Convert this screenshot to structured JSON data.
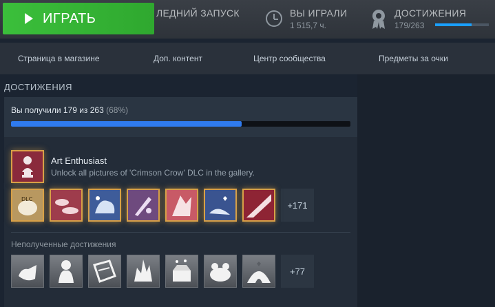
{
  "topbar": {
    "play_label": "ИГРАТЬ",
    "last_launch_label": "ЛЕДНИЙ ЗАПУСК",
    "played_label": "ВЫ ИГРАЛИ",
    "played_value": "1 515,7 ч.",
    "achievements_label": "ДОСТИЖЕНИЯ",
    "achievements_value": "179/263",
    "achievements_progress": 0.68,
    "accent_color": "#1a9fff",
    "play_color": "#3bbf3b"
  },
  "nav": {
    "items": [
      {
        "label": "Страница в магазине"
      },
      {
        "label": "Доп. контент"
      },
      {
        "label": "Центр сообщества"
      },
      {
        "label": "Предметы за очки"
      }
    ]
  },
  "achievements": {
    "section_title": "ДОСТИЖЕНИЯ",
    "progress_text": "Вы получили 179 из 263",
    "progress_pct": "(68%)",
    "progress": 0.68,
    "featured": {
      "name": "Art Enthusiast",
      "description": "Unlock all pictures of 'Crimson Crow' DLC in the gallery.",
      "icon": "bust-statue-icon"
    },
    "unlocked": {
      "icons": [
        "dlc-chest-icon",
        "clouds-icon",
        "blue-plush-icon",
        "paintbrush-icon",
        "character-art-icon",
        "heart-hand-icon",
        "crimson-frame-icon"
      ],
      "more_label": "+171"
    },
    "locked": {
      "title": "Неполученные достижения",
      "icons": [
        "open-hand-icon",
        "ghost-figure-icon",
        "broken-frame-icon",
        "fire-icon",
        "gift-box-icon",
        "frog-icon",
        "heart-cave-icon"
      ],
      "more_label": "+77"
    }
  }
}
